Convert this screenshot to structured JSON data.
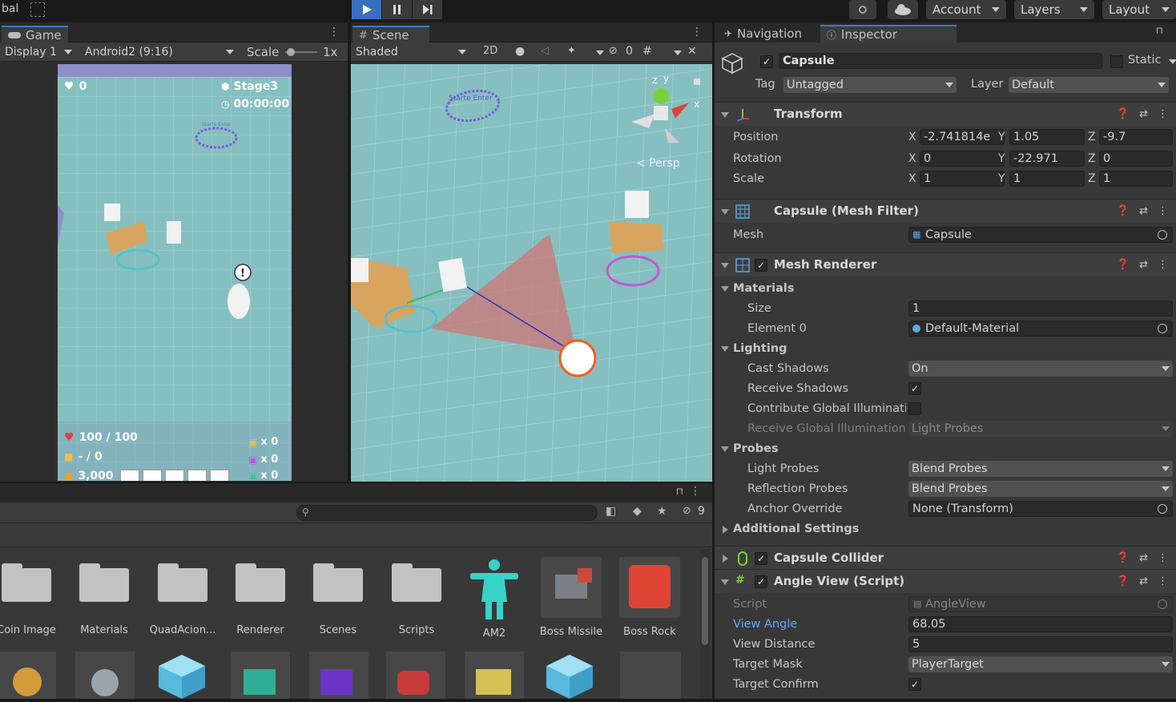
{
  "toolbar": {
    "left_label": "bal",
    "account": "Account",
    "layers": "Layers",
    "layout": "Layout"
  },
  "game_view": {
    "tab": "Game",
    "display": "Display 1",
    "resolution": "Android2 (9:16)",
    "scale_label": "Scale",
    "scale_value": "1x",
    "hud": {
      "hearts": "0",
      "stage": "Stage3",
      "timer": "00:00:00",
      "hp": "100 / 100",
      "ammo": "- / 0",
      "coins": "3,000",
      "count1": "x 0",
      "count2": "x 0",
      "count3": "x 0",
      "portal_text": "Starte Enter"
    }
  },
  "scene_view": {
    "tab": "Scene",
    "shading": "Shaded",
    "mode_2d": "2D",
    "hidden_count": "0",
    "persp": "< Persp",
    "portal_text": "Starte Enter"
  },
  "project": {
    "search_placeholder": "",
    "hidden_count": "9",
    "assets_row1": [
      {
        "label": "Coin Image",
        "kind": "folder"
      },
      {
        "label": "Materials",
        "kind": "folder"
      },
      {
        "label": "QuadAcion...",
        "kind": "folder"
      },
      {
        "label": "Renderer",
        "kind": "folder"
      },
      {
        "label": "Scenes",
        "kind": "folder"
      },
      {
        "label": "Scripts",
        "kind": "folder"
      },
      {
        "label": "AM2",
        "kind": "avatar"
      },
      {
        "label": "Boss Missile",
        "kind": "thumb"
      },
      {
        "label": "Boss Rock",
        "kind": "thumb"
      }
    ]
  },
  "inspector": {
    "tabs": {
      "navigation": "Navigation",
      "inspector": "Inspector"
    },
    "object_name": "Capsule",
    "static_label": "Static",
    "tag_label": "Tag",
    "tag_value": "Untagged",
    "layer_label": "Layer",
    "layer_value": "Default",
    "transform": {
      "title": "Transform",
      "position_label": "Position",
      "rotation_label": "Rotation",
      "scale_label": "Scale",
      "position": {
        "x": "-2.741814e",
        "y": "1.05",
        "z": "-9.7"
      },
      "rotation": {
        "x": "0",
        "y": "-22.971",
        "z": "0"
      },
      "scale": {
        "x": "1",
        "y": "1",
        "z": "1"
      }
    },
    "mesh_filter": {
      "title": "Capsule (Mesh Filter)",
      "mesh_label": "Mesh",
      "mesh_value": "Capsule"
    },
    "mesh_renderer": {
      "title": "Mesh Renderer",
      "materials": "Materials",
      "size_label": "Size",
      "size_value": "1",
      "element0_label": "Element 0",
      "element0_value": "Default-Material",
      "lighting": "Lighting",
      "cast_shadows_label": "Cast Shadows",
      "cast_shadows_value": "On",
      "receive_shadows_label": "Receive Shadows",
      "contribute_gi_label": "Contribute Global Illuminatic",
      "receive_gi_label": "Receive Global Illumination",
      "receive_gi_value": "Light Probes",
      "probes": "Probes",
      "light_probes_label": "Light Probes",
      "light_probes_value": "Blend Probes",
      "reflection_probes_label": "Reflection Probes",
      "reflection_probes_value": "Blend Probes",
      "anchor_override_label": "Anchor Override",
      "anchor_override_value": "None (Transform)",
      "additional_settings": "Additional Settings"
    },
    "capsule_collider": {
      "title": "Capsule Collider"
    },
    "angle_view": {
      "title": "Angle View (Script)",
      "script_label": "Script",
      "script_value": "AngleView",
      "view_angle_label": "View Angle",
      "view_angle_value": "68.05",
      "view_distance_label": "View Distance",
      "view_distance_value": "5",
      "target_mask_label": "Target Mask",
      "target_mask_value": "PlayerTarget",
      "target_confirm_label": "Target Confirm"
    }
  },
  "colors": {
    "accent": "#3a79d6",
    "play_active": "#3a6fbf",
    "ground": "#86bfc0",
    "panel": "#383838",
    "highlight_label": "#6aa6ff"
  }
}
